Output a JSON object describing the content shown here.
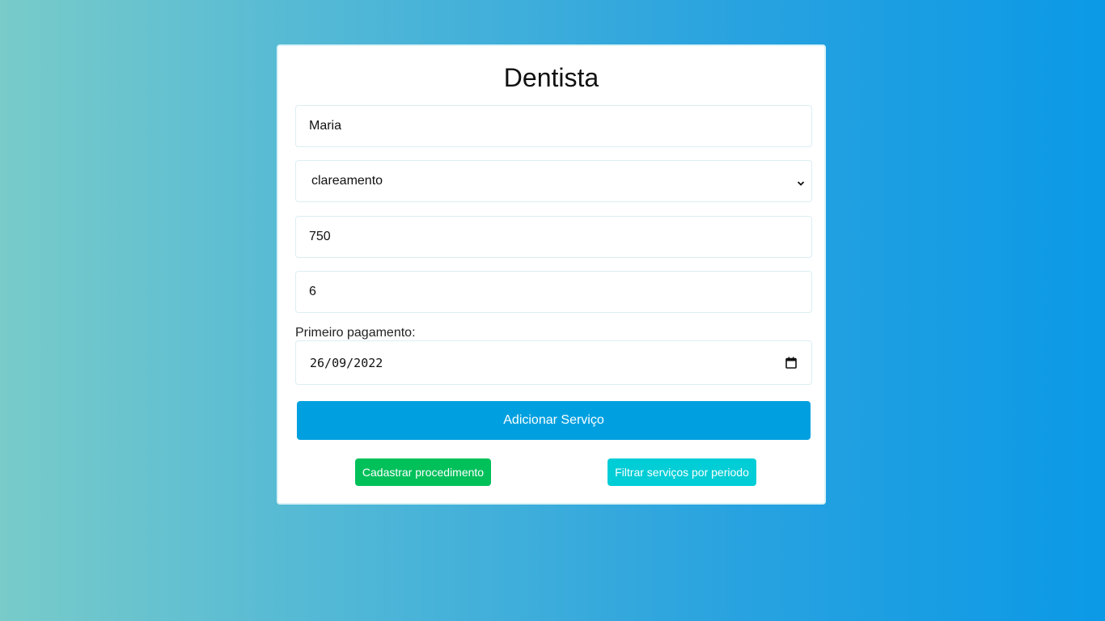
{
  "form": {
    "title": "Dentista",
    "name_value": "Maria",
    "procedure_selected": "clareamento",
    "value_input": "750",
    "installments_input": "6",
    "first_payment_label": "Primeiro pagamento:",
    "first_payment_value": "26/09/2022",
    "submit_label": "Adicionar Serviço"
  },
  "actions": {
    "register_label": "Cadastrar procedimento",
    "filter_label": "Filtrar serviços por periodo"
  },
  "colors": {
    "primary": "#00a0e0",
    "success": "#00c05a",
    "info": "#00cdd6"
  },
  "icons": {
    "select": "chevron-down-icon",
    "date": "calendar-icon"
  }
}
